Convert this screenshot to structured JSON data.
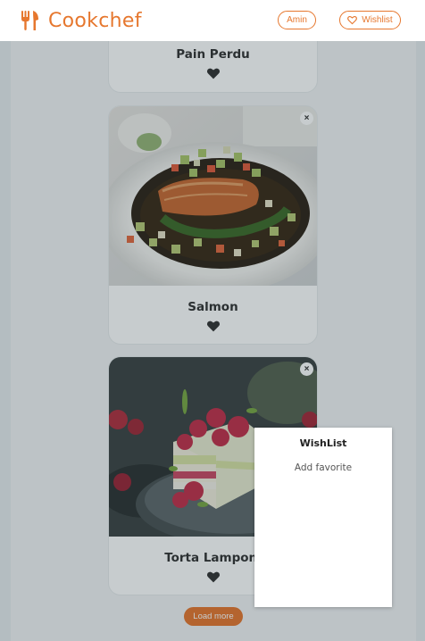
{
  "header": {
    "brand": "Cookchef",
    "user_button": "Amin",
    "wishlist_button": "Wishlist"
  },
  "recipes": [
    {
      "title": "Pain Perdu",
      "icon": "heart-icon",
      "remove_label": "×"
    },
    {
      "title": "Salmon",
      "icon": "heart-icon",
      "remove_label": "×"
    },
    {
      "title": "Torta Lamponi",
      "icon": "heart-icon",
      "remove_label": "×"
    }
  ],
  "load_more": "Load more",
  "wishlist_panel": {
    "title": "WishList",
    "empty_text": "Add favorite"
  },
  "colors": {
    "accent": "#e6772e",
    "overlay": "rgba(20,40,50,0.24)"
  }
}
